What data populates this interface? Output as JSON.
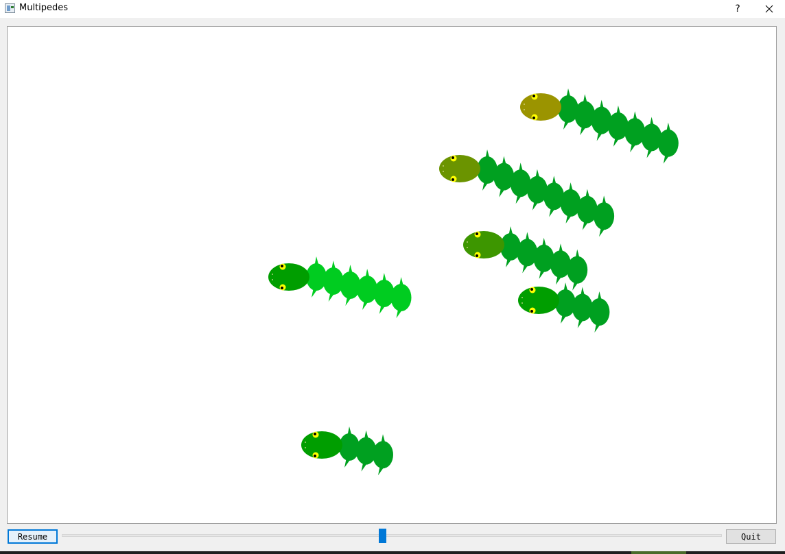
{
  "window": {
    "title": "Multipedes",
    "help_label": "?"
  },
  "controls": {
    "resume_label": "Resume",
    "quit_label": "Quit",
    "slider_value_fraction": 0.486
  },
  "colors": {
    "segment_dark": "#00a020",
    "segment_light": "#00cc20",
    "head_olive": "#9b9400",
    "head_olive_green": "#6b9400",
    "head_green": "#3d9600",
    "head_dark": "#009e00",
    "eye": "#ffff00",
    "accent": "#0078d7"
  },
  "multipedes": [
    {
      "head": "head_olive",
      "body": "segment_dark",
      "segments": 7
    },
    {
      "head": "head_olive_green",
      "body": "segment_dark",
      "segments": 8
    },
    {
      "head": "head_green",
      "body": "segment_dark",
      "segments": 5
    },
    {
      "head": "head_dark",
      "body": "segment_light",
      "segments": 6
    },
    {
      "head": "head_dark",
      "body": "segment_dark",
      "segments": 3
    },
    {
      "head": "head_dark",
      "body": "segment_dark",
      "segments": 3
    }
  ]
}
